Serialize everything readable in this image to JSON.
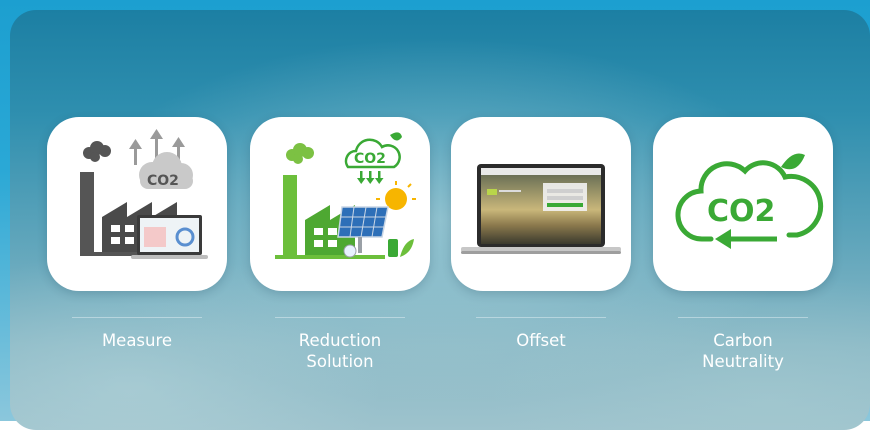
{
  "items": [
    {
      "label": "Measure",
      "icon": "factory-co2-laptop-icon",
      "icon_text": "CO2"
    },
    {
      "label": "Reduction\nSolution",
      "icon": "green-factory-solar-icon",
      "icon_text": "CO2"
    },
    {
      "label": "Offset",
      "icon": "laptop-screen-icon"
    },
    {
      "label": "Carbon\nNeutrality",
      "icon": "co2-cloud-icon",
      "icon_text": "CO2"
    }
  ],
  "colors": {
    "green": "#3aa935",
    "gray": "#6b6b6b",
    "background": "#2f8faf"
  }
}
